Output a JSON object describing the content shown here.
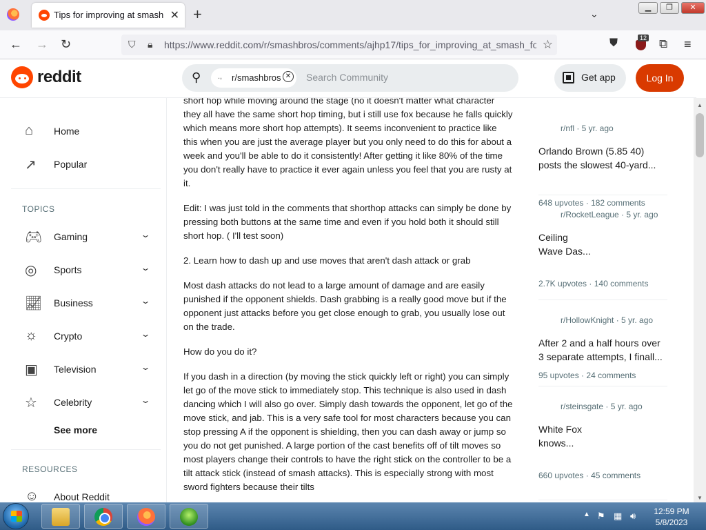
{
  "browser": {
    "tab_title": "Tips for improving at smash for",
    "url": "https://www.reddit.com/r/smashbros/comments/ajhp17/tips_for_improving_at_smash_fo",
    "extension_count": "12"
  },
  "header": {
    "wordmark": "reddit",
    "community_chip": "r/smashbros",
    "search_placeholder": "Search Community",
    "get_app": "Get app",
    "login": "Log In"
  },
  "sidebar": {
    "items": [
      {
        "label": "Home"
      },
      {
        "label": "Popular"
      }
    ],
    "topics_heading": "TOPICS",
    "topics": [
      {
        "label": "Gaming"
      },
      {
        "label": "Sports"
      },
      {
        "label": "Business"
      },
      {
        "label": "Crypto"
      },
      {
        "label": "Television"
      },
      {
        "label": "Celebrity"
      }
    ],
    "see_more": "See more",
    "resources_heading": "RESOURCES",
    "about": "About Reddit"
  },
  "post": {
    "paragraphs": [
      "short hop while moving around the stage (no it doesn't matter what character they all have the same short hop timing, but i still use fox because he falls quickly which means more short hop attempts). It seems  inconvenient to practice like this when you are just the average player but you only need to do this for about a week and you'll be able to do it consistently! After getting it like 80% of the time you don't really have to practice it ever again unless you feel that you are rusty at it.",
      "Edit: I was just told in the comments that shorthop attacks can simply be done by pressing both buttons at the same time and even if you hold both it should still short hop. ( I'll test soon)",
      "2. Learn how to dash up and use moves that aren't dash attack or grab",
      "Most dash attacks do not lead to a large amount of damage and are easily punished if the opponent shields. Dash grabbing is a really good move but if the opponent just attacks before you get close enough to grab, you usually lose out on the trade.",
      "How do you do it?",
      "If you dash in a direction (by moving the stick quickly left or right) you can simply let go of the move stick to immediately stop. This technique is also used in dash dancing  which I will also go over. Simply dash towards the opponent, let go of the move stick, and jab. This is a very safe tool for most characters because you can stop pressing A if the opponent is shielding, then you can dash away or jump so you do not get punished. A large portion of the cast benefits off of tilt moves so most players change their controls to have the right stick on the controller to be a tilt attack stick (instead of smash attacks). This is especially strong with most sword fighters because their tilts"
    ]
  },
  "related": [
    {
      "meta": "r/nfl · 5 yr. ago",
      "title": "Orlando Brown (5.85 40) posts the slowest 40-yard...",
      "upvotes": "648 upvotes",
      "comments": "182 comments"
    },
    {
      "meta": "r/RocketLeague · 5 yr. ago",
      "title": "Ceiling\nWave Das...",
      "upvotes": "2.7K upvotes",
      "comments": "140 comments"
    },
    {
      "meta": "r/HollowKnight · 5 yr. ago",
      "title": "After 2 and a half hours over 3 separate attempts, I finall...",
      "upvotes": "95 upvotes",
      "comments": "24 comments"
    },
    {
      "meta": "r/steinsgate · 5 yr. ago",
      "title": "White Fox\nknows...",
      "upvotes": "660 upvotes",
      "comments": "45 comments"
    }
  ],
  "taskbar": {
    "time": "12:59 PM",
    "date": "5/8/2023"
  },
  "colors": {
    "brand": "#ff4500",
    "login_button": "#d93a00"
  }
}
